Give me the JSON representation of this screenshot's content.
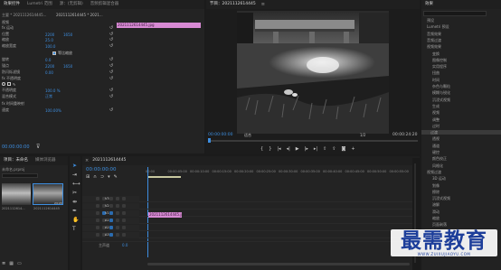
{
  "effect_controls": {
    "tabs": [
      "效果控件",
      "Lumetri 范围",
      "源：(无剪辑)",
      "音频剪辑混合器"
    ],
    "active_tab": 0,
    "source_label": "主要 * 2021112614445...",
    "sequence_label": "2021112614445 * 2021...",
    "clip_label": "2021112614445.jpg",
    "rows": [
      {
        "label": "视频",
        "value": "",
        "value2": ""
      },
      {
        "label": "fx 运动",
        "value": "",
        "value2": ""
      },
      {
        "label": "位置",
        "value": "2200",
        "value2": "1650"
      },
      {
        "label": "缩放",
        "value": "25.0",
        "value2": ""
      },
      {
        "label": "缩放宽度",
        "value": "100.0",
        "value2": ""
      },
      {
        "label": "",
        "value": "",
        "value2": "",
        "check": "等比缩放"
      },
      {
        "label": "旋转",
        "value": "0.0",
        "value2": ""
      },
      {
        "label": "锚点",
        "value": "2200",
        "value2": "1650"
      },
      {
        "label": "防闪烁滤镜",
        "value": "0.00",
        "value2": ""
      },
      {
        "label": "fx 不透明度",
        "value": "",
        "value2": ""
      },
      {
        "label": "",
        "value": "",
        "value2": ""
      },
      {
        "label": "不透明度",
        "value": "100.0 %",
        "value2": ""
      },
      {
        "label": "混合模式",
        "value": "正常",
        "value2": ""
      },
      {
        "label": "fx 时间重映射",
        "value": "",
        "value2": ""
      },
      {
        "label": "速度",
        "value": "100.00%",
        "value2": ""
      }
    ],
    "timecode": "00:00:00:00"
  },
  "program": {
    "title": "节目：2021112614445",
    "timecode_left": "00:00:00:00",
    "fit_label": "适合",
    "ratio_label": "1/2",
    "timecode_right": "00:00:24:20"
  },
  "effects_panel": {
    "title": "效果",
    "items": [
      {
        "label": "预设",
        "level": 0
      },
      {
        "label": "Lumetri 预设",
        "level": 0
      },
      {
        "label": "音频效果",
        "level": 0
      },
      {
        "label": "音频过渡",
        "level": 0
      },
      {
        "label": "视频效果",
        "level": 0
      },
      {
        "label": "变换",
        "level": 1
      },
      {
        "label": "图像控制",
        "level": 1
      },
      {
        "label": "实用程序",
        "level": 1
      },
      {
        "label": "扭曲",
        "level": 1
      },
      {
        "label": "时间",
        "level": 1
      },
      {
        "label": "杂色与颗粒",
        "level": 1
      },
      {
        "label": "模糊与锐化",
        "level": 1
      },
      {
        "label": "沉浸式视频",
        "level": 1
      },
      {
        "label": "生成",
        "level": 1
      },
      {
        "label": "视频",
        "level": 1
      },
      {
        "label": "调整",
        "level": 1
      },
      {
        "label": "过时",
        "level": 1
      },
      {
        "label": "过渡",
        "level": 1
      },
      {
        "label": "透视",
        "level": 1
      },
      {
        "label": "通道",
        "level": 1
      },
      {
        "label": "键控",
        "level": 1
      },
      {
        "label": "颜色校正",
        "level": 1
      },
      {
        "label": "风格化",
        "level": 1
      },
      {
        "label": "视频过渡",
        "level": 0
      },
      {
        "label": "3D 运动",
        "level": 1
      },
      {
        "label": "划像",
        "level": 1
      },
      {
        "label": "擦除",
        "level": 1
      },
      {
        "label": "沉浸式视频",
        "level": 1
      },
      {
        "label": "溶解",
        "level": 1
      },
      {
        "label": "滑动",
        "level": 1
      },
      {
        "label": "缩放",
        "level": 1
      },
      {
        "label": "页面剥落",
        "level": 1
      }
    ],
    "selected_index": 17
  },
  "project": {
    "tabs": [
      "项目：未命名",
      "媒体浏览器"
    ],
    "file_label": "未命名.prproj",
    "items": [
      {
        "name": "2021112614...",
        "duration": ""
      },
      {
        "name": "2021112614445",
        "duration": "24:20"
      }
    ]
  },
  "timeline": {
    "title": "2021112614445",
    "timecode": "00:00:00:00",
    "ruler": [
      "00:00",
      "00:00:05:00",
      "00:00:10:00",
      "00:00:15:00",
      "00:00:20:00",
      "00:00:25:00",
      "00:00:30:00",
      "00:00:35:00",
      "00:00:40:00",
      "00:00:45:00",
      "00:00:50:00",
      "00:00:55:00"
    ],
    "tracks": [
      "V3",
      "V2",
      "V1",
      "A1",
      "A2",
      "A3"
    ],
    "master_label": "主声道",
    "master_value": "0.0",
    "clip_label": "2021112614445.jpg"
  },
  "watermark": {
    "main": "最需教育",
    "sub": "WWW.ZUIXUJIAOYU.COM"
  }
}
